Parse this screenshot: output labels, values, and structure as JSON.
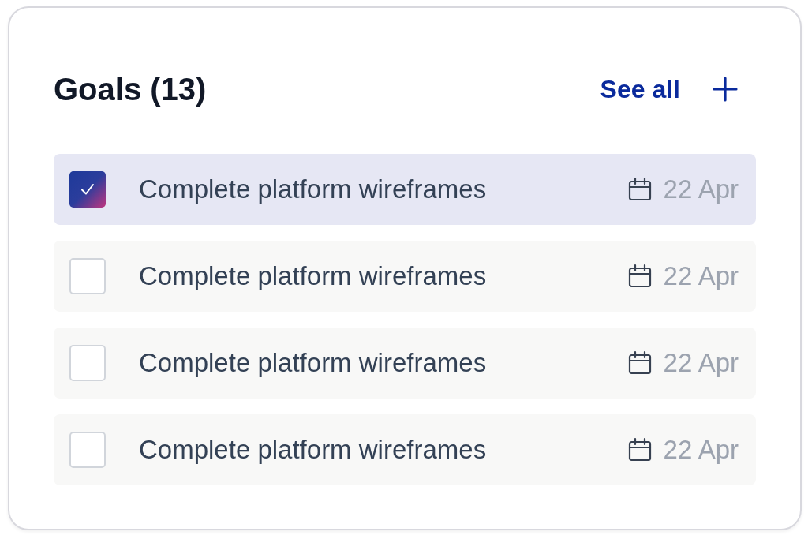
{
  "header": {
    "title": "Goals (13)",
    "see_all": "See all"
  },
  "goals": [
    {
      "label": "Complete platform wireframes",
      "date": "22 Apr",
      "checked": true,
      "selected": true
    },
    {
      "label": "Complete platform wireframes",
      "date": "22 Apr",
      "checked": false,
      "selected": false
    },
    {
      "label": "Complete platform wireframes",
      "date": "22 Apr",
      "checked": false,
      "selected": false
    },
    {
      "label": "Complete platform wireframes",
      "date": "22 Apr",
      "checked": false,
      "selected": false
    }
  ]
}
